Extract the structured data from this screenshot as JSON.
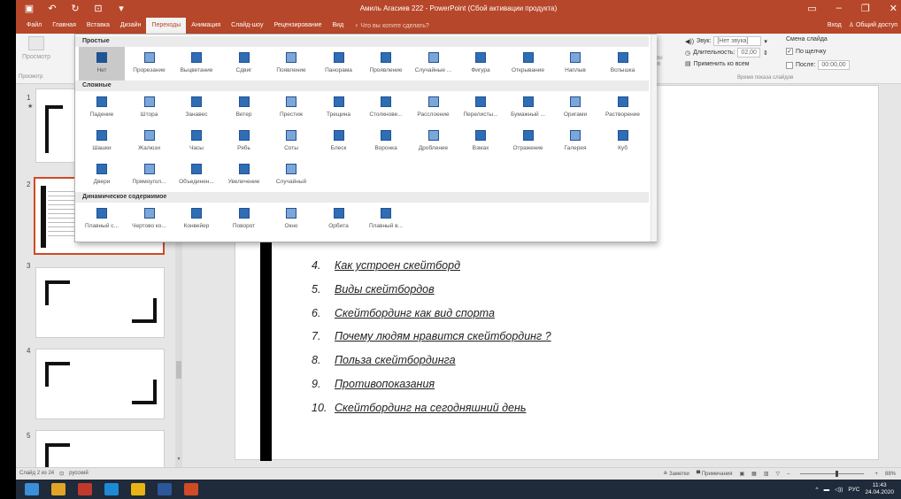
{
  "titlebar": {
    "title": "Амиль Агасиев 222 - PowerPoint (Сбой активации продукта)",
    "quick_access": [
      "save-icon",
      "undo-icon",
      "redo-icon",
      "present-icon",
      "customize-icon"
    ],
    "window_controls": [
      "ribbon-options-icon",
      "minimize-icon",
      "maximize-icon",
      "close-icon"
    ]
  },
  "tabs": {
    "items": [
      {
        "label": "Файл"
      },
      {
        "label": "Главная"
      },
      {
        "label": "Вставка"
      },
      {
        "label": "Дизайн"
      },
      {
        "label": "Переходы"
      },
      {
        "label": "Анимация"
      },
      {
        "label": "Слайд-шоу"
      },
      {
        "label": "Рецензирование"
      },
      {
        "label": "Вид"
      }
    ],
    "active_index": 4,
    "tellme": "♀ Что вы хотите сделать?",
    "signin": "Вход",
    "share": "♙ Общий доступ"
  },
  "ribbon": {
    "preview_label": "Просмотр",
    "preview_group": "Просмотр",
    "params_label": "Параметры эффектов",
    "sound_label": "Звук:",
    "sound_value": "[Нет звука]",
    "duration_label": "Длительность:",
    "duration_value": "02,00",
    "apply_all": "Применить ко всем",
    "advance_label": "Смена слайда",
    "on_click": "По щелчку",
    "after_label": "После:",
    "after_value": "00:00,00",
    "timing_group": "Время показа слайдов"
  },
  "gallery": {
    "sections": [
      {
        "title": "Простые",
        "items": [
          "Нет",
          "Прорезание",
          "Выцветание",
          "Сдвиг",
          "Появление",
          "Панорама",
          "Проявление",
          "Случайные ...",
          "Фигура",
          "Открывание",
          "Наплыв",
          "Вспышка"
        ]
      },
      {
        "title": "Сложные",
        "items": [
          "Падение",
          "Штора",
          "Занавес",
          "Ветер",
          "Престиж",
          "Трещина",
          "Столкнове...",
          "Расслоение",
          "Перелисты...",
          "Бумажный ...",
          "Оригами",
          "Растворение",
          "Шашки",
          "Жалюзи",
          "Часы",
          "Рябь",
          "Соты",
          "Блеск",
          "Воронка",
          "Дробление",
          "Взмах",
          "Отражение",
          "Галерея",
          "Куб",
          "Двери",
          "Прямоугол...",
          "Объединен...",
          "Увеличение",
          "Случайный"
        ]
      },
      {
        "title": "Динамическое содержимое",
        "items": [
          "Плавный с...",
          "Чертово ко...",
          "Конвейер",
          "Поворот",
          "Окно",
          "Орбита",
          "Плавный в..."
        ]
      }
    ],
    "selected": "Нет"
  },
  "slides": {
    "numbers": [
      "1",
      "2",
      "3",
      "4",
      "5"
    ],
    "selected_index": 1
  },
  "slide_content": {
    "items": [
      {
        "num": "4.",
        "text": "Как устроен скейтборд"
      },
      {
        "num": "5.",
        "text": "Виды скейтбордов"
      },
      {
        "num": "6.",
        "text": "Скейтбординг как вид спорта"
      },
      {
        "num": "7.",
        "text": "Почему людям нравится скейтбординг ?"
      },
      {
        "num": "8.",
        "text": "Польза скейтбординга"
      },
      {
        "num": "9.",
        "text": "Противопоказания"
      },
      {
        "num": "10.",
        "text": "Скейтбординг на сегодняшний день"
      }
    ]
  },
  "status": {
    "slide_info": "Слайд 2 из 24",
    "language": "русский",
    "notes": "≜ Заметки",
    "comments": "▀ Примечания",
    "zoom": "88%",
    "zoom_fraction": 0.55
  },
  "taskbar": {
    "apps": [
      "windows-start-icon",
      "file-explorer-icon",
      "media-icon",
      "edge-icon",
      "chrome-icon",
      "word-icon",
      "powerpoint-icon"
    ],
    "lang": "РУС",
    "time": "11:43",
    "date": "24.04.2020"
  },
  "colors": {
    "accent": "#b7472a",
    "selection_border": "#d04a25",
    "icon_blue": "#2f6db5",
    "taskbar": "#1f2a3a"
  }
}
